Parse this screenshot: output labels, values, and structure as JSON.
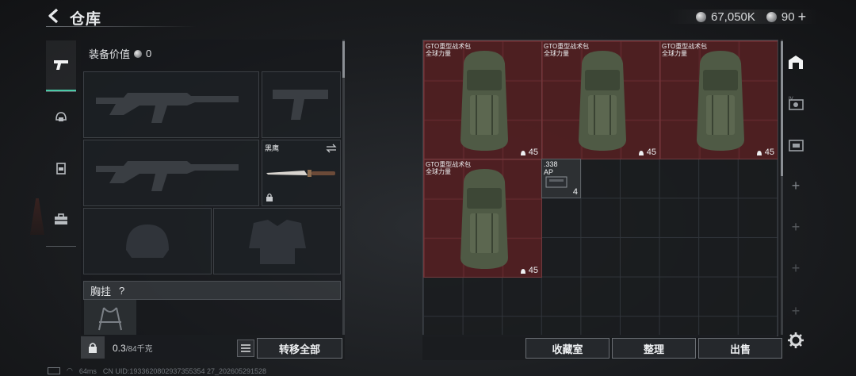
{
  "header": {
    "title": "仓库",
    "currency_value": "67,050K",
    "premium_value": "90",
    "premium_plus": "+"
  },
  "left_tabs": [
    {
      "name": "weapon-tab",
      "icon": "pistol-icon",
      "active": true
    },
    {
      "name": "helmet-tab",
      "icon": "helmet-icon",
      "active": false
    },
    {
      "name": "vest-tab",
      "icon": "vest-icon",
      "active": false
    },
    {
      "name": "toolbox-tab",
      "icon": "toolbox-icon",
      "active": false
    }
  ],
  "equipment": {
    "value_label": "装备价值",
    "value": "0",
    "melee_label": "黑鹰",
    "chest_label": "胸挂",
    "chest_help": "?"
  },
  "footer_left": {
    "weight_value": "0.3",
    "weight_max": "/84千克",
    "transfer_all": "转移全部"
  },
  "storage": {
    "items": [
      {
        "name": "GTO重型战术包",
        "sub": "全球力量",
        "count": "45"
      },
      {
        "name": "GTO重型战术包",
        "sub": "全球力量",
        "count": "45"
      },
      {
        "name": "GTO重型战术包",
        "sub": "全球力量",
        "count": "45"
      },
      {
        "name": "GTO重型战术包",
        "sub": "全球力量",
        "count": "45"
      }
    ],
    "ammo": {
      "line1": ".338",
      "line2": "AP",
      "count": "4"
    }
  },
  "footer_right": {
    "collection": "收藏室",
    "organize": "整理",
    "sell": "出售"
  },
  "status": {
    "ping": "64ms",
    "uid": "CN UID:1933620802937355354 27_202605291528"
  },
  "colors": {
    "accent": "#49c9a6",
    "item_bg": "#5c2023"
  }
}
